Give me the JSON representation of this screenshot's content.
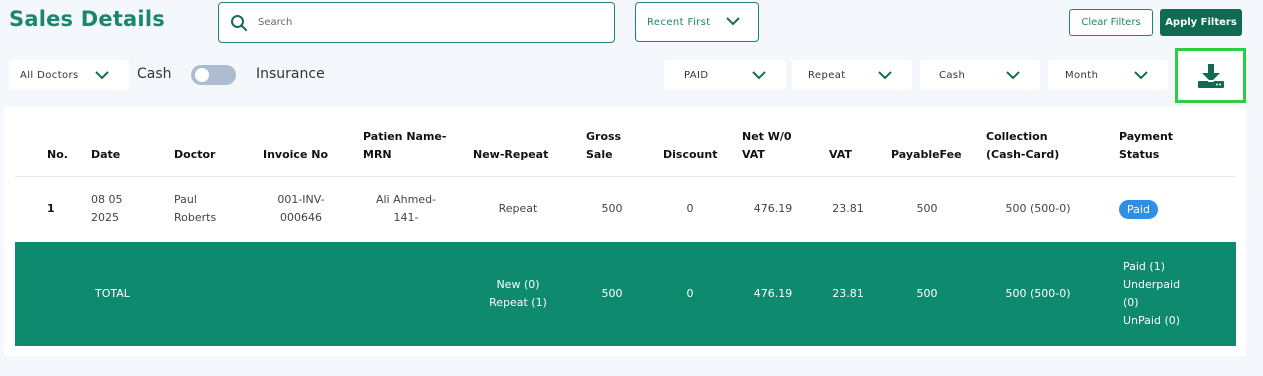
{
  "page_title": "Sales Details",
  "search": {
    "placeholder": "Search"
  },
  "sort": {
    "selected": "Recent First"
  },
  "buttons": {
    "clear": "Clear Filters",
    "apply": "Apply Filters"
  },
  "filters": {
    "doctor": "All Doctors",
    "cash_label": "Cash",
    "insurance_label": "Insurance",
    "payment_status": "PAID",
    "visit_type": "Repeat",
    "payment_method": "Cash",
    "period": "Month"
  },
  "colors": {
    "accent": "#1a8670",
    "total_bg": "#0e8a6e",
    "badge": "#2f8ee6",
    "highlight": "#2ecc40"
  },
  "table": {
    "headers": {
      "no": "No.",
      "date": "Date",
      "doctor": "Doctor",
      "invoice": "Invoice No",
      "patient_1": "Patien Name-",
      "patient_2": "MRN",
      "new_repeat": "New-Repeat",
      "gross_1": "Gross",
      "gross_2": "Sale",
      "discount": "Discount",
      "net_1": "Net W/0",
      "net_2": "VAT",
      "vat": "VAT",
      "payable": "PayableFee",
      "collection_1": "Collection",
      "collection_2": "(Cash-Card)",
      "status_1": "Payment",
      "status_2": "Status"
    },
    "rows": [
      {
        "no": "1",
        "date_1": "08 05",
        "date_2": "2025",
        "doctor_1": "Paul",
        "doctor_2": "Roberts",
        "invoice_1": "001-INV-",
        "invoice_2": "000646",
        "patient_1": "Ali Ahmed-",
        "patient_2": "141-",
        "new_repeat": "Repeat",
        "gross": "500",
        "discount": "0",
        "net": "476.19",
        "vat": "23.81",
        "payable": "500",
        "collection": "500 (500-0)",
        "status": "Paid"
      }
    ],
    "total": {
      "label": "TOTAL",
      "new": "New (0)",
      "repeat": "Repeat (1)",
      "gross": "500",
      "discount": "0",
      "net": "476.19",
      "vat": "23.81",
      "payable": "500",
      "collection": "500 (500-0)",
      "paid": "Paid (1)",
      "underpaid_1": "Underpaid",
      "underpaid_2": "(0)",
      "unpaid": "UnPaid (0)"
    }
  },
  "icons": {
    "search": "search-icon",
    "chevron": "chevron-down-icon",
    "download": "download-icon"
  }
}
